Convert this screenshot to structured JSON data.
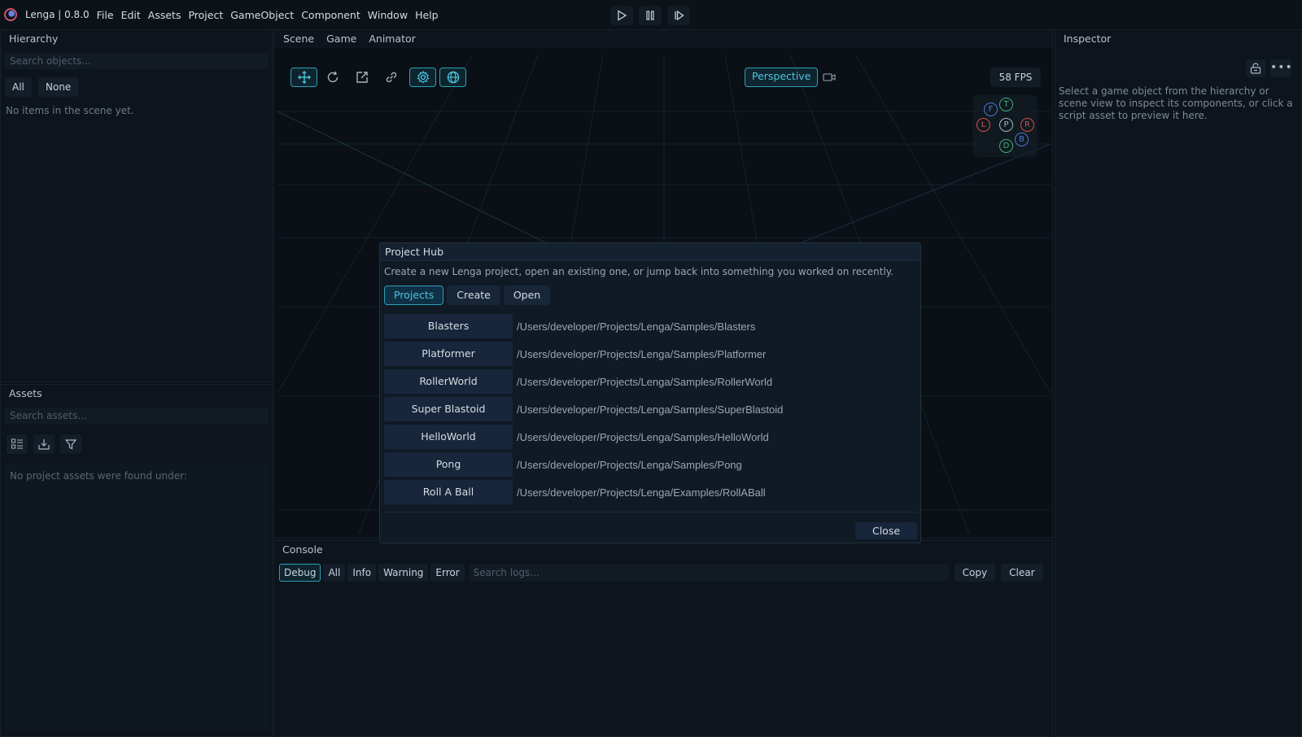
{
  "app": {
    "title": "Lenga | 0.8.0"
  },
  "menu": [
    "File",
    "Edit",
    "Assets",
    "Project",
    "GameObject",
    "Component",
    "Window",
    "Help"
  ],
  "hierarchy": {
    "title": "Hierarchy",
    "search_placeholder": "Search objects...",
    "filter_all": "All",
    "filter_none": "None",
    "empty_text": "No items in the scene yet."
  },
  "assets": {
    "title": "Assets",
    "search_placeholder": "Search assets...",
    "empty_text": "No project assets were found under:"
  },
  "scene": {
    "tabs": [
      "Scene",
      "Game",
      "Animator"
    ],
    "perspective_label": "Perspective",
    "fps_label": "58 FPS",
    "gizmo": {
      "top": "T",
      "front": "F",
      "left": "L",
      "center": "P",
      "right": "R",
      "back": "B",
      "down": "D"
    }
  },
  "inspector": {
    "title": "Inspector",
    "more_label": "•••",
    "message": "Select a game object from the hierarchy or scene view to inspect its components, or click a script asset to preview it here."
  },
  "console": {
    "title": "Console",
    "filters": [
      "Debug",
      "All",
      "Info",
      "Warning",
      "Error"
    ],
    "search_placeholder": "Search logs...",
    "copy_label": "Copy",
    "clear_label": "Clear"
  },
  "project_hub": {
    "title": "Project Hub",
    "description": "Create a new Lenga project, open an existing one, or jump back into something you worked on recently.",
    "tabs": [
      "Projects",
      "Create",
      "Open"
    ],
    "projects": [
      {
        "name": "Blasters",
        "path": "/Users/developer/Projects/Lenga/Samples/Blasters"
      },
      {
        "name": "Platformer",
        "path": "/Users/developer/Projects/Lenga/Samples/Platformer"
      },
      {
        "name": "RollerWorld",
        "path": "/Users/developer/Projects/Lenga/Samples/RollerWorld"
      },
      {
        "name": "Super Blastoid",
        "path": "/Users/developer/Projects/Lenga/Samples/SuperBlastoid"
      },
      {
        "name": "HelloWorld",
        "path": "/Users/developer/Projects/Lenga/Samples/HelloWorld"
      },
      {
        "name": "Pong",
        "path": "/Users/developer/Projects/Lenga/Samples/Pong"
      },
      {
        "name": "Roll A Ball",
        "path": "/Users/developer/Projects/Lenga/Examples/RollABall"
      }
    ],
    "close_label": "Close"
  },
  "colors": {
    "accent": "#2aa0b8",
    "accent_text": "#4ec3dc",
    "background": "#0b1117"
  }
}
